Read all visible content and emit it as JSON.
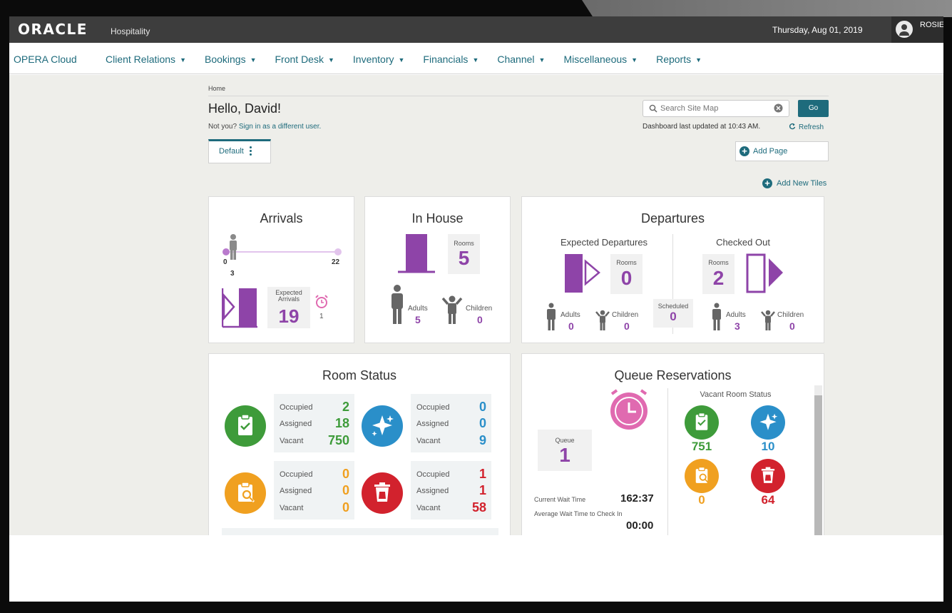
{
  "topbar": {
    "logo": "ORACLE",
    "logo_suffix": "Hospitality",
    "date": "Thursday, Aug 01, 2019",
    "user": "ROSIE"
  },
  "nav": {
    "home": "OPERA Cloud",
    "items": [
      {
        "label": "Client Relations"
      },
      {
        "label": "Bookings"
      },
      {
        "label": "Front Desk"
      },
      {
        "label": "Inventory"
      },
      {
        "label": "Financials"
      },
      {
        "label": "Channel"
      },
      {
        "label": "Miscellaneous"
      },
      {
        "label": "Reports"
      }
    ]
  },
  "page": {
    "breadcrumb": "Home",
    "greeting": "Hello, David!",
    "not_you": "Not you?",
    "sign_in_link": "Sign in as a different user.",
    "tab_default": "Default",
    "search_placeholder": "Search Site Map",
    "go": "Go",
    "last_updated": "Dashboard last updated at 10:43 AM.",
    "refresh": "Refresh",
    "add_page": "Add Page",
    "add_tiles": "Add New Tiles"
  },
  "arrivals": {
    "title": "Arrivals",
    "slider_min": "0",
    "slider_max": "22",
    "current": "3",
    "expected_label": "Expected Arrivals",
    "expected": "19",
    "alarm_count": "1"
  },
  "inhouse": {
    "title": "In House",
    "rooms_label": "Rooms",
    "rooms": "5",
    "adults_label": "Adults",
    "adults": "5",
    "children_label": "Children",
    "children": "0"
  },
  "departures": {
    "title": "Departures",
    "expected_title": "Expected Departures",
    "checked_title": "Checked Out",
    "rooms_label": "Rooms",
    "expected_rooms": "0",
    "checked_rooms": "2",
    "scheduled_label": "Scheduled",
    "scheduled": "0",
    "adults_label": "Adults",
    "children_label": "Children",
    "exp_adults": "0",
    "exp_children": "0",
    "chk_adults": "3",
    "chk_children": "0"
  },
  "room_status": {
    "title": "Room Status",
    "occupied_label": "Occupied",
    "assigned_label": "Assigned",
    "vacant_label": "Vacant",
    "groups": [
      {
        "name": "clean",
        "color": "#3e9b3a",
        "occupied": "2",
        "assigned": "18",
        "vacant": "750"
      },
      {
        "name": "inspected",
        "color": "#2a8fc9",
        "occupied": "0",
        "assigned": "0",
        "vacant": "9"
      },
      {
        "name": "pickup",
        "color": "#f0a020",
        "occupied": "0",
        "assigned": "0",
        "vacant": "0"
      },
      {
        "name": "dirty",
        "color": "#d2222d",
        "occupied": "1",
        "assigned": "1",
        "vacant": "58"
      }
    ]
  },
  "queue": {
    "title": "Queue Reservations",
    "queue_label": "Queue",
    "queue": "1",
    "current_wait_label": "Current Wait Time",
    "current_wait": "162:37",
    "avg_wait_label": "Average Wait Time to Check In",
    "avg_wait": "00:00",
    "vacant_title": "Vacant Room Status",
    "vacant_clean": "751",
    "vacant_inspected": "10",
    "vacant_pickup": "0",
    "vacant_dirty": "64"
  }
}
